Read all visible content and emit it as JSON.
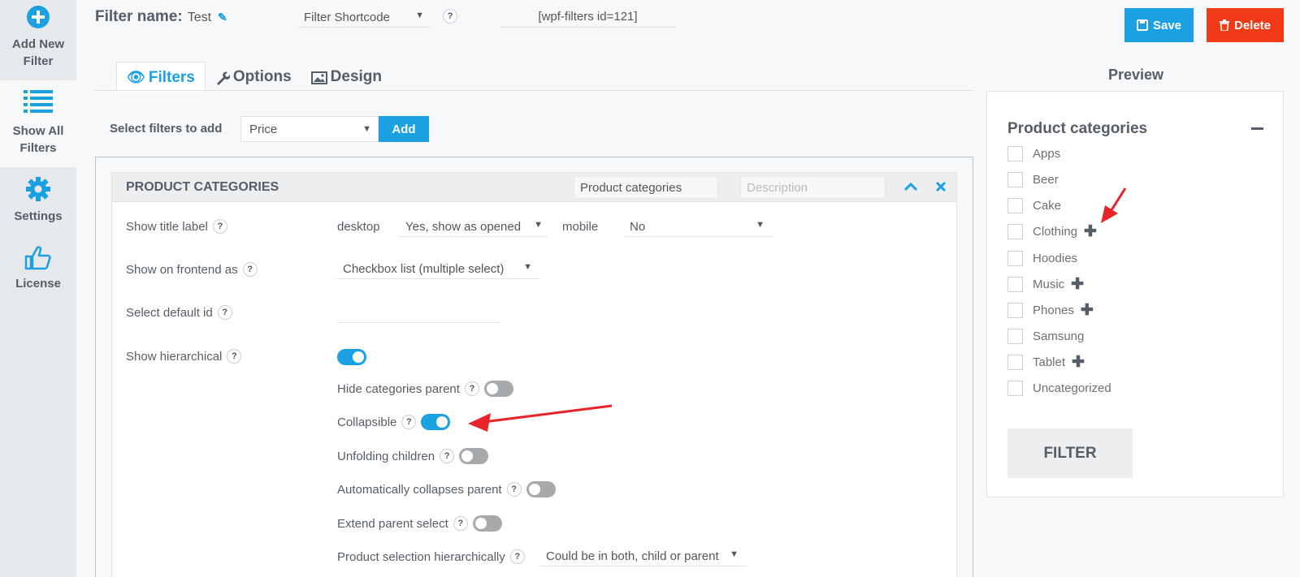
{
  "sidebar": {
    "items": [
      {
        "label": "Add New Filter",
        "line1": "Add New",
        "line2": "Filter",
        "icon": "plus-circle-icon"
      },
      {
        "label": "Show All Filters",
        "line1": "Show All",
        "line2": "Filters",
        "icon": "list-icon"
      },
      {
        "label": "Settings",
        "line1": "Settings",
        "line2": "",
        "icon": "gear-icon"
      },
      {
        "label": "License",
        "line1": "License",
        "line2": "",
        "icon": "thumbs-up-icon"
      }
    ]
  },
  "header": {
    "filter_name_label": "Filter name:",
    "filter_name_value": "Test",
    "shortcode_select": "Filter Shortcode",
    "shortcode_value": "[wpf-filters id=121]",
    "help": "?",
    "save_label": "Save",
    "delete_label": "Delete"
  },
  "tabs": [
    {
      "label": "Filters",
      "active": true
    },
    {
      "label": "Options",
      "active": false
    },
    {
      "label": "Design",
      "active": false
    }
  ],
  "preview": {
    "title": "Preview",
    "panel_title": "Product categories",
    "categories": [
      {
        "label": "Apps",
        "expandable": false
      },
      {
        "label": "Beer",
        "expandable": false
      },
      {
        "label": "Cake",
        "expandable": false
      },
      {
        "label": "Clothing",
        "expandable": true
      },
      {
        "label": "Hoodies",
        "expandable": false
      },
      {
        "label": "Music",
        "expandable": true
      },
      {
        "label": "Phones",
        "expandable": true
      },
      {
        "label": "Samsung",
        "expandable": false
      },
      {
        "label": "Tablet",
        "expandable": true
      },
      {
        "label": "Uncategorized",
        "expandable": false
      }
    ],
    "filter_button": "FILTER"
  },
  "add_filter": {
    "label": "Select filters to add",
    "selected": "Price",
    "add_button": "Add"
  },
  "filter_block": {
    "title": "PRODUCT CATEGORIES",
    "title_input": "Product categories",
    "description_placeholder": "Description",
    "rows": {
      "show_title_label": "Show title label",
      "desktop": "desktop",
      "desktop_value": "Yes, show as opened",
      "mobile": "mobile",
      "mobile_value": "No",
      "show_on_frontend": "Show on frontend as",
      "frontend_value": "Checkbox list (multiple select)",
      "select_default_id": "Select default id",
      "show_hierarchical": "Show hierarchical",
      "hide_categories_parent": "Hide categories parent",
      "collapsible": "Collapsible",
      "unfolding_children": "Unfolding children",
      "auto_collapses_parent": "Automatically collapses parent",
      "extend_parent_select": "Extend parent select",
      "product_selection_hier": "Product selection hierarchically",
      "product_selection_value": "Could be in both, child or parent"
    },
    "toggles": {
      "show_hierarchical": true,
      "hide_categories_parent": false,
      "collapsible": true,
      "unfolding_children": false,
      "auto_collapses_parent": false,
      "extend_parent_select": false
    }
  },
  "colors": {
    "accent": "#1ba0e2",
    "danger": "#f13b18",
    "annotation": "#e8242b"
  }
}
